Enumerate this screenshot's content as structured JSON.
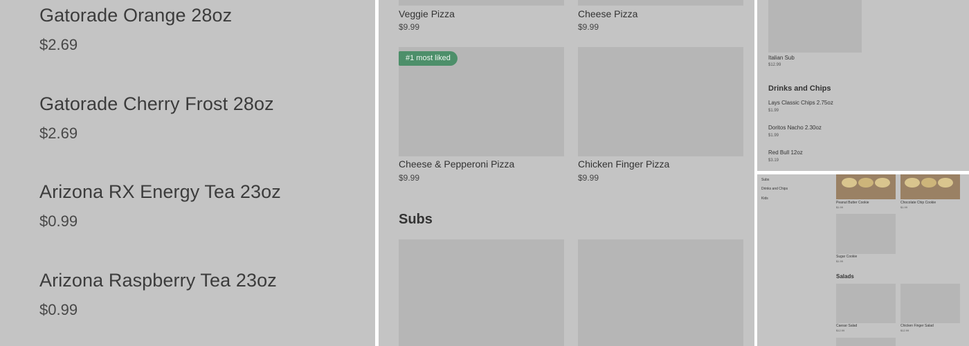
{
  "left_panel": {
    "items": [
      {
        "name": "Gatorade Orange 28oz",
        "price": "$2.69"
      },
      {
        "name": "Gatorade Cherry Frost 28oz",
        "price": "$2.69"
      },
      {
        "name": "Arizona RX Energy Tea 23oz",
        "price": "$0.99"
      },
      {
        "name": "Arizona Raspberry Tea 23oz",
        "price": "$0.99"
      }
    ]
  },
  "middle_panel": {
    "items": [
      {
        "name": "Veggie Pizza",
        "price": "$9.99"
      },
      {
        "name": "Cheese Pizza",
        "price": "$9.99"
      },
      {
        "name": "Cheese & Pepperoni Pizza",
        "price": "$9.99",
        "badge": "#1 most liked"
      },
      {
        "name": "Chicken Finger Pizza",
        "price": "$9.99"
      }
    ],
    "section_title": "Subs"
  },
  "right_top_panel": {
    "item": {
      "name": "Italian Sub",
      "price": "$12.99"
    },
    "section_title": "Drinks and Chips",
    "items": [
      {
        "name": "Lays Classic Chips 2.75oz",
        "price": "$1.99"
      },
      {
        "name": "Doritos Nacho 2.30oz",
        "price": "$1.99"
      },
      {
        "name": "Red Bull 12oz",
        "price": "$3.19"
      }
    ]
  },
  "right_bottom_panel": {
    "categories": [
      "Subs",
      "Drinks and Chips",
      "Kids"
    ],
    "cookies": [
      {
        "name": "Peanut Butter Cookie",
        "price": "$1.99"
      },
      {
        "name": "Chocolate Chip Cookie",
        "price": "$1.99"
      },
      {
        "name": "Sugar Cookie",
        "price": "$1.99"
      }
    ],
    "section_title": "Salads",
    "salads": [
      {
        "name": "Caesar Salad",
        "price": "$12.99"
      },
      {
        "name": "Chicken Finger Salad",
        "price": "$12.99"
      }
    ]
  },
  "colors": {
    "panel_bg": "#c4c4c4",
    "image_placeholder": "#b6b6b6",
    "badge_green": "#4d8f6a"
  }
}
